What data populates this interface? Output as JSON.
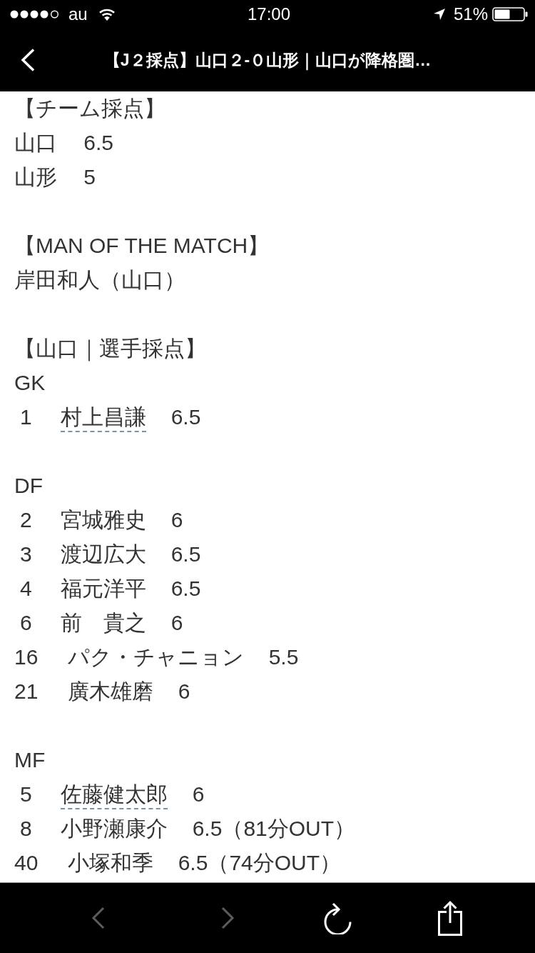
{
  "status_bar": {
    "carrier": "au",
    "time": "17:00",
    "battery": "51%"
  },
  "nav_bar": {
    "title": "【J２採点】山口２-０山形｜山口が降格圏…"
  },
  "article": {
    "sections": [
      {
        "kind": "team_ratings",
        "heading": "【チーム採点】",
        "rows": [
          {
            "team": "山口",
            "score": "6.5"
          },
          {
            "team": "山形",
            "score": "5"
          }
        ]
      },
      {
        "kind": "text",
        "heading": "【MAN OF THE MATCH】",
        "lines": [
          "岸田和人（山口）"
        ]
      },
      {
        "kind": "player_ratings",
        "heading": "【山口｜選手採点】",
        "groups": [
          {
            "position": "GK",
            "players": [
              {
                "number": "1",
                "name": "村上昌謙",
                "rating": "6.5",
                "linked": true
              }
            ]
          },
          {
            "position": "DF",
            "players": [
              {
                "number": "2",
                "name": "宮城雅史",
                "rating": "6",
                "linked": false
              },
              {
                "number": "3",
                "name": "渡辺広大",
                "rating": "6.5",
                "linked": false
              },
              {
                "number": "4",
                "name": "福元洋平",
                "rating": "6.5",
                "linked": false
              },
              {
                "number": "6",
                "name": "前　貴之",
                "rating": "6",
                "linked": false
              },
              {
                "number": "16",
                "name": "パク・チャニョン",
                "rating": "5.5",
                "linked": false
              },
              {
                "number": "21",
                "name": "廣木雄磨",
                "rating": "6",
                "linked": false
              }
            ]
          },
          {
            "position": "MF",
            "players": [
              {
                "number": "5",
                "name": "佐藤健太郎",
                "rating": "6",
                "linked": true
              },
              {
                "number": "8",
                "name": "小野瀬康介",
                "rating": "6.5（81分OUT）",
                "linked": false
              },
              {
                "number": "40",
                "name": "小塚和季",
                "rating": "6.5（74分OUT）",
                "linked": false
              }
            ]
          }
        ]
      }
    ]
  },
  "toolbar": {
    "buttons": [
      {
        "kind": "back",
        "disabled": true
      },
      {
        "kind": "forward",
        "disabled": true
      },
      {
        "kind": "reload",
        "disabled": false
      },
      {
        "kind": "share",
        "disabled": false
      }
    ]
  }
}
